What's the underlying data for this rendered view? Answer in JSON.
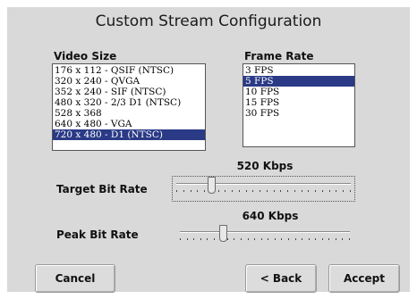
{
  "dialog": {
    "title": "Custom Stream Configuration"
  },
  "video_size": {
    "label": "Video Size",
    "options": [
      "176 x 112 - QSIF (NTSC)",
      "320 x 240 - QVGA",
      "352 x 240 - SIF (NTSC)",
      "480 x 320 - 2/3 D1 (NTSC)",
      "528 x 368",
      "640 x 480 - VGA",
      "720 x 480 - D1 (NTSC)"
    ],
    "selected_index": 6
  },
  "frame_rate": {
    "label": "Frame Rate",
    "options": [
      "3 FPS",
      "5 FPS",
      "10 FPS",
      "15 FPS",
      "30 FPS"
    ],
    "selected_index": 1
  },
  "target_bit_rate": {
    "label": "Target Bit Rate",
    "value_text": "520 Kbps",
    "slider_fraction": 0.2,
    "tick_count": 26
  },
  "peak_bit_rate": {
    "label": "Peak Bit Rate",
    "value_text": "640 Kbps",
    "slider_fraction": 0.25,
    "tick_count": 26
  },
  "buttons": {
    "cancel": "Cancel",
    "back": "< Back",
    "accept": "Accept"
  },
  "colors": {
    "selection": "#2a3a86",
    "panel": "#d9d9d9"
  }
}
